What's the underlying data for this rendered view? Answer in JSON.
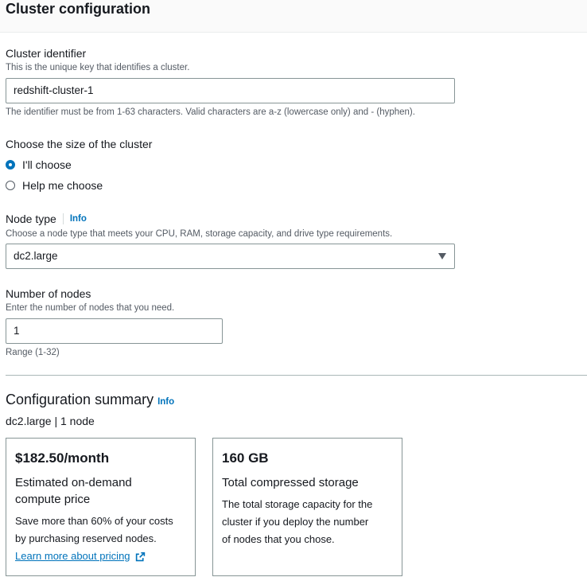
{
  "header": {
    "title": "Cluster configuration"
  },
  "cluster_identifier": {
    "label": "Cluster identifier",
    "description": "This is the unique key that identifies a cluster.",
    "value": "redshift-cluster-1",
    "constraint": "The identifier must be from 1-63 characters. Valid characters are a-z (lowercase only) and - (hyphen)."
  },
  "cluster_size": {
    "label": "Choose the size of the cluster",
    "options": [
      {
        "label": "I'll choose",
        "selected": true
      },
      {
        "label": "Help me choose",
        "selected": false
      }
    ]
  },
  "node_type": {
    "label": "Node type",
    "info": "Info",
    "description": "Choose a node type that meets your CPU, RAM, storage capacity, and drive type requirements.",
    "value": "dc2.large"
  },
  "number_of_nodes": {
    "label": "Number of nodes",
    "description": "Enter the number of nodes that you need.",
    "value": "1",
    "range": "Range (1-32)"
  },
  "summary": {
    "title": "Configuration summary",
    "info": "Info",
    "subtitle": "dc2.large | 1 node",
    "price_card": {
      "amount": "$182.50/month",
      "label_line1": "Estimated on-demand",
      "label_line2": "compute price",
      "text_line1": "Save more than 60% of your costs",
      "text_line2": "by purchasing reserved nodes.",
      "link": "Learn more about pricing"
    },
    "storage_card": {
      "amount": "160 GB",
      "label": "Total compressed storage",
      "text_line1": "The total storage capacity for the",
      "text_line2": "cluster if you deploy the number",
      "text_line3": "of nodes that you chose."
    }
  },
  "colors": {
    "accent": "#0073bb",
    "text": "#16191f",
    "muted": "#545b64",
    "border": "#879596"
  },
  "icons": {
    "external_link": "external-link-icon",
    "dropdown": "caret-down-icon"
  }
}
